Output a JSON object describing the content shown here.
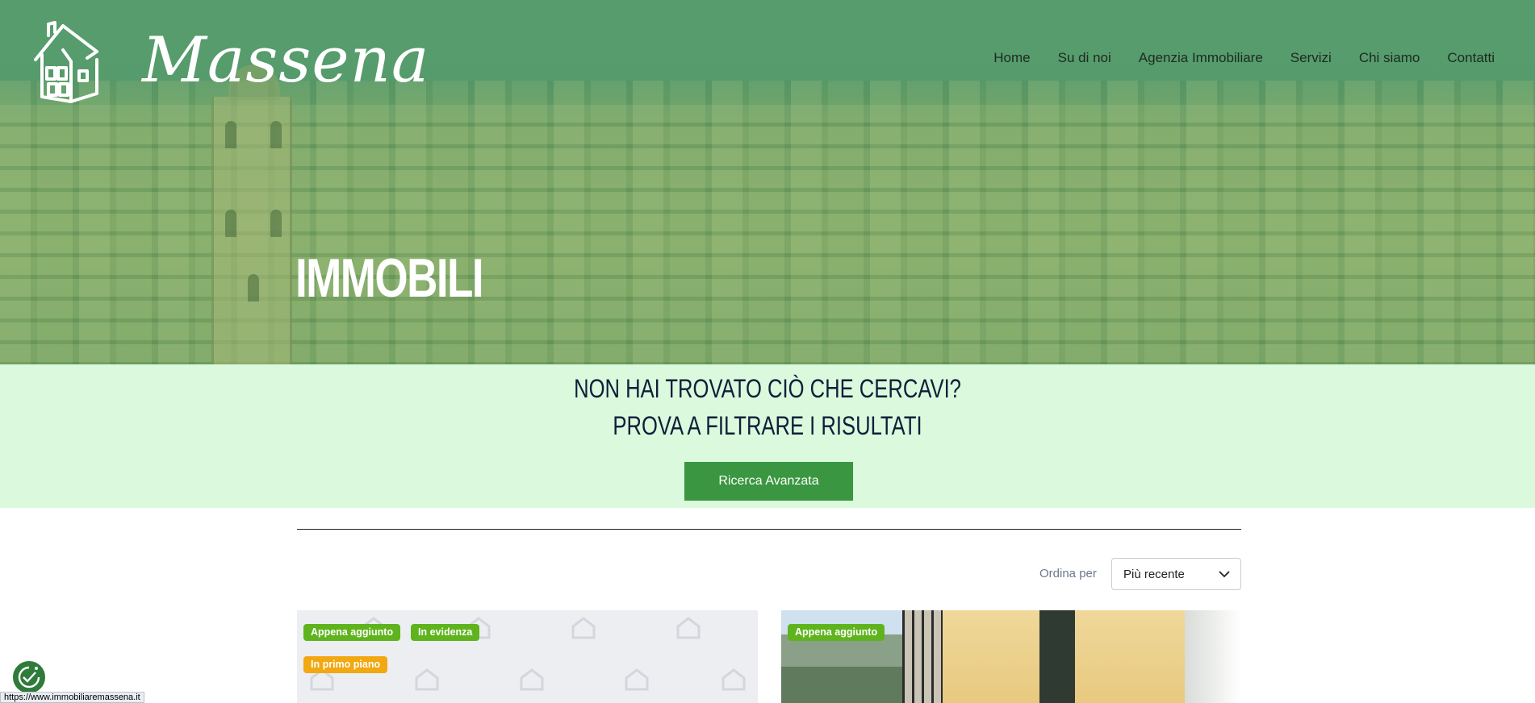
{
  "brand": {
    "name": "Massena"
  },
  "nav": {
    "items": [
      {
        "label": "Home"
      },
      {
        "label": "Su di noi"
      },
      {
        "label": "Agenzia Immobiliare"
      },
      {
        "label": "Servizi"
      },
      {
        "label": "Chi siamo"
      },
      {
        "label": "Contatti"
      }
    ]
  },
  "hero": {
    "title": "IMMOBILI"
  },
  "cta": {
    "line1": "NON HAI TROVATO CIÒ CHE CERCAVI?",
    "line2": "PROVA A FILTRARE I RISULTATI",
    "button": "Ricerca Avanzata"
  },
  "sort": {
    "label": "Ordina per",
    "selected": "Più recente"
  },
  "listings": [
    {
      "badges": [
        "Appena aggiunto",
        "In evidenza",
        "In primo piano"
      ]
    },
    {
      "badges": [
        "Appena aggiunto"
      ]
    }
  ],
  "status_bar": {
    "url": "https://www.immobiliaremassena.it"
  },
  "colors": {
    "hero_tint": "#5f9f74",
    "cta_bg": "#dbf9dc",
    "button": "#3a9640",
    "badge_green": "#5fb41e",
    "badge_orange": "#f2a811",
    "title_text": "#0f1f3a"
  }
}
